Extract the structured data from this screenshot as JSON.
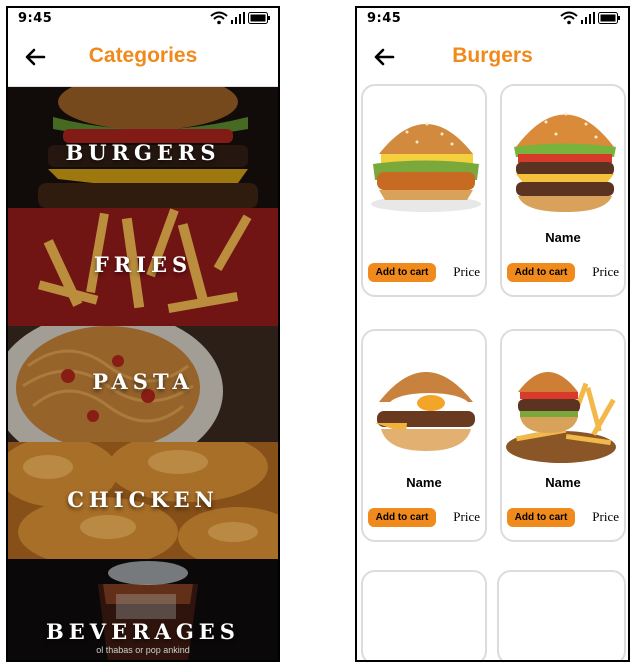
{
  "left_screen": {
    "status_time": "9:45",
    "title": "Categories",
    "categories": [
      {
        "label": "BURGERS"
      },
      {
        "label": "FRIES"
      },
      {
        "label": "PASTA"
      },
      {
        "label": "CHICKEN"
      },
      {
        "label": "BEVERAGES"
      }
    ],
    "overlay_small_text": "ol thabas or pop ankind"
  },
  "right_screen": {
    "status_time": "9:45",
    "title": "Burgers",
    "products": [
      {
        "name": "",
        "add_label": "Add to cart",
        "price": "Price"
      },
      {
        "name": "Name",
        "add_label": "Add to cart",
        "price": "Price"
      },
      {
        "name": "Name",
        "add_label": "Add to cart",
        "price": "Price"
      },
      {
        "name": "Name",
        "add_label": "Add to cart",
        "price": "Price"
      }
    ]
  },
  "colors": {
    "accent": "#f08a1c",
    "card_border": "#dcdcdc"
  },
  "icons": [
    "back-arrow-icon",
    "wifi-icon",
    "signal-icon",
    "battery-icon"
  ]
}
